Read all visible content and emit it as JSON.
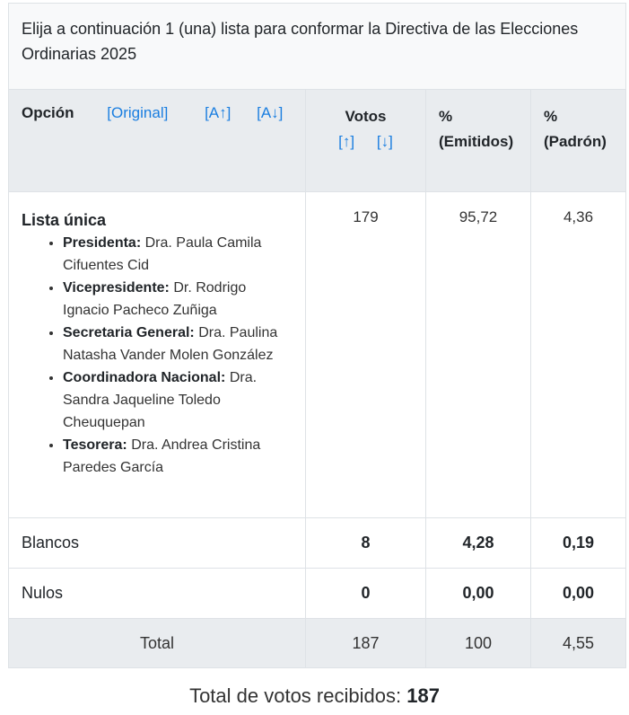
{
  "question": "Elija a continuación 1 (una) lista para conformar la Directiva de las Elecciones Ordinarias 2025",
  "header": {
    "option_label": "Opción",
    "sort_original": "[Original]",
    "sort_alpha_asc": "[A↑]",
    "sort_alpha_desc": "[A↓]",
    "votes_label": "Votos",
    "sort_votes_asc": "[↑]",
    "sort_votes_desc": "[↓]",
    "pct_symbol": "%",
    "pct_emitted": "(Emitidos)",
    "pct_roll": "(Padrón)"
  },
  "lista": {
    "name": "Lista única",
    "votes": "179",
    "pct_emitted": "95,72",
    "pct_roll": "4,36",
    "members": [
      {
        "role": "Presidenta:",
        "name": "Dra. Paula Camila Cifuentes Cid"
      },
      {
        "role": "Vicepresidente:",
        "name": "Dr. Rodrigo Ignacio Pacheco Zuñiga"
      },
      {
        "role": "Secretaria General:",
        "name": "Dra. Paulina Natasha Vander Molen González"
      },
      {
        "role": "Coordinadora Nacional:",
        "name": "Dra. Sandra Jaqueline Toledo Cheuquepan"
      },
      {
        "role": "Tesorera:",
        "name": "Dra. Andrea Cristina Paredes García"
      }
    ]
  },
  "blancos": {
    "label": "Blancos",
    "votes": "8",
    "pct_emitted": "4,28",
    "pct_roll": "0,19"
  },
  "nulos": {
    "label": "Nulos",
    "votes": "0",
    "pct_emitted": "0,00",
    "pct_roll": "0,00"
  },
  "total": {
    "label": "Total",
    "votes": "187",
    "pct_emitted": "100",
    "pct_roll": "4,55"
  },
  "summary": {
    "label": "Total de votos recibidos:",
    "value": "187"
  }
}
